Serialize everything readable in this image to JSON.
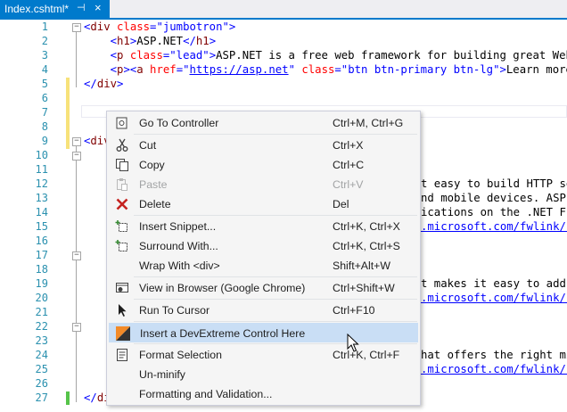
{
  "tab": {
    "title": "Index.cshtml*",
    "pin_glyph": "⊣",
    "close_glyph": "×"
  },
  "line_numbers": [
    "1",
    "2",
    "3",
    "4",
    "5",
    "6",
    "7",
    "8",
    "9",
    "10",
    "11",
    "12",
    "13",
    "14",
    "15",
    "16",
    "17",
    "18",
    "19",
    "20",
    "21",
    "22",
    "23",
    "24",
    "25",
    "26",
    "27"
  ],
  "code": {
    "l1": {
      "open": "<",
      "tag": "div",
      "attr": " class",
      "eq": "=",
      "val": "\"jumbotron\"",
      "close": ">"
    },
    "l2": {
      "pre": "    ",
      "open": "<",
      "tag": "h1",
      "gt": ">",
      "text": "ASP.NET",
      "endopen": "</",
      "endtag": "h1",
      "endgt": ">"
    },
    "l3": {
      "pre": "    ",
      "open": "<",
      "tag": "p",
      "attr": " class",
      "eq": "=",
      "val": "\"lead\"",
      "gt": ">",
      "text": "ASP.NET is a free web framework for building great Web si"
    },
    "l4": {
      "pre": "    ",
      "open": "<",
      "tag": "p",
      "gt": ">",
      "open2": "<",
      "tag2": "a",
      "attr": " href",
      "eq": "=",
      "q1": "\"",
      "link": "https://asp.net",
      "q2": "\"",
      "attr2": " class",
      "eq2": "=",
      "val2": "\"btn btn-primary btn-lg\"",
      "gt2": ">",
      "text": "Learn more &"
    },
    "l5": {
      "open": "</",
      "tag": "div",
      "gt": ">"
    },
    "l9": {
      "open": "<",
      "tag": "div"
    },
    "l12": "t easy to build HTTP se",
    "l13": "nd mobile devices. ASP.",
    "l14": "ications on the .NET Fr",
    "l15": ".microsoft.com/fwlink/?",
    "l20": "t makes it easy to add,",
    "l21": ".microsoft.com/fwlink/?",
    "l25": "hat offers the right mi",
    "l26": ".microsoft.com/fwlink/?",
    "l27": {
      "open": "</",
      "tag": "di"
    }
  },
  "context_menu": {
    "items": [
      {
        "label": "Go To Controller",
        "shortcut": "Ctrl+M, Ctrl+G",
        "icon": "go-to-controller-icon"
      },
      {
        "label": "Cut",
        "shortcut": "Ctrl+X",
        "icon": "scissors-icon"
      },
      {
        "label": "Copy",
        "shortcut": "Ctrl+C",
        "icon": "copy-icon"
      },
      {
        "label": "Paste",
        "shortcut": "Ctrl+V",
        "icon": "paste-icon",
        "disabled": true
      },
      {
        "label": "Delete",
        "shortcut": "Del",
        "icon": "delete-x-icon"
      },
      {
        "label": "Insert Snippet...",
        "shortcut": "Ctrl+K, Ctrl+X",
        "icon": "insert-snippet-icon"
      },
      {
        "label": "Surround With...",
        "shortcut": "Ctrl+K, Ctrl+S",
        "icon": "surround-with-icon"
      },
      {
        "label": "Wrap With <div>",
        "shortcut": "Shift+Alt+W",
        "icon": ""
      },
      {
        "label": "View in Browser (Google Chrome)",
        "shortcut": "Ctrl+Shift+W",
        "icon": "view-in-browser-icon"
      },
      {
        "label": "Run To Cursor",
        "shortcut": "Ctrl+F10",
        "icon": "run-to-cursor-icon"
      },
      {
        "label": "Insert a DevExtreme Control Here",
        "shortcut": "",
        "icon": "devextreme-icon",
        "highlighted": true
      },
      {
        "label": "Format Selection",
        "shortcut": "Ctrl+K, Ctrl+F",
        "icon": "format-selection-icon"
      },
      {
        "label": "Un-minify",
        "shortcut": "",
        "icon": ""
      },
      {
        "label": "Formatting and Validation...",
        "shortcut": "",
        "icon": ""
      }
    ]
  },
  "colors": {
    "accent": "#007acc",
    "highlight": "#c9def5",
    "line_number": "#2b91af",
    "tag": "#800000",
    "attribute": "#ff0000",
    "value": "#0000ff",
    "modified_bar": "#f7e27a",
    "saved_bar": "#56c44a"
  }
}
